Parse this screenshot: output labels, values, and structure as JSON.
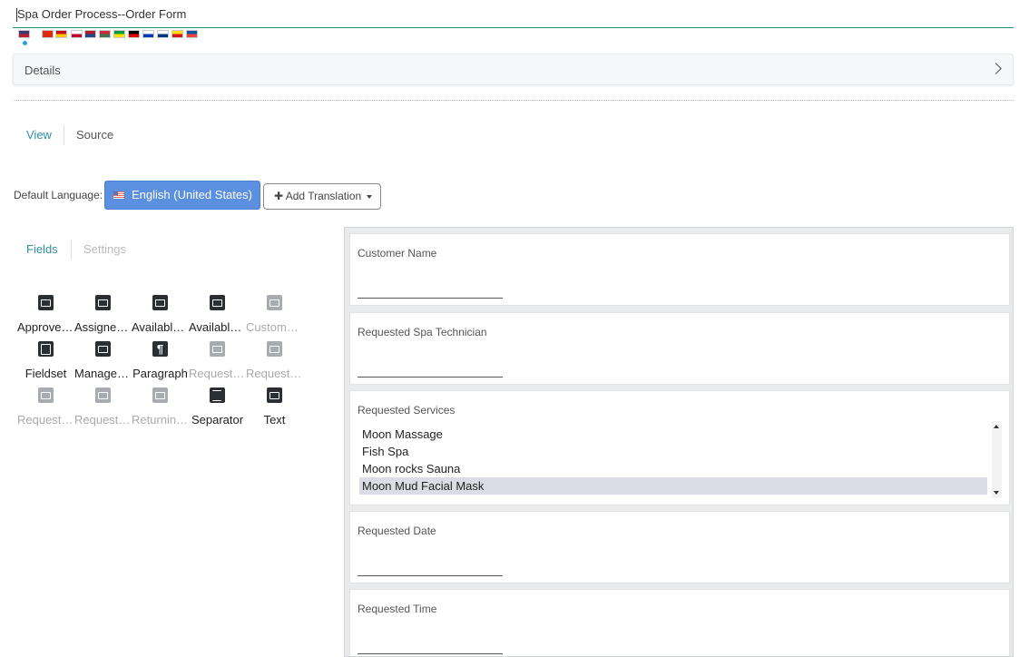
{
  "header": {
    "title": "Spa Order Process--Order Form"
  },
  "flags": [
    {
      "name": "us-flag-icon",
      "c1": "#3c3b6e",
      "c2": "#b22234"
    },
    {
      "name": "cn-flag-icon",
      "c1": "#de2910",
      "c2": "#de2910"
    },
    {
      "name": "es-flag-icon",
      "c1": "#c60b1e",
      "c2": "#ffc400"
    },
    {
      "name": "jp-flag-icon",
      "c1": "#ffffff",
      "c2": "#bc002d"
    },
    {
      "name": "nl-flag-icon",
      "c1": "#ae1c28",
      "c2": "#21468b"
    },
    {
      "name": "hu-flag-icon",
      "c1": "#ce2939",
      "c2": "#477050"
    },
    {
      "name": "br-flag-icon",
      "c1": "#009c3b",
      "c2": "#ffdf00"
    },
    {
      "name": "de-flag-icon",
      "c1": "#000000",
      "c2": "#dd0000"
    },
    {
      "name": "il-flag-icon",
      "c1": "#ffffff",
      "c2": "#0038b8"
    },
    {
      "name": "fi-flag-icon",
      "c1": "#ffffff",
      "c2": "#003580"
    },
    {
      "name": "ca-flag-icon",
      "c1": "#fcdd09",
      "c2": "#da121a"
    },
    {
      "name": "fr-flag-icon",
      "c1": "#0055a4",
      "c2": "#ef4135"
    }
  ],
  "details": {
    "label": "Details"
  },
  "view_tabs": {
    "view": "View",
    "source": "Source"
  },
  "language": {
    "label": "Default Language:",
    "selected": "English (United States)",
    "add_translation": "Add Translation"
  },
  "palette_tabs": {
    "fields": "Fields",
    "settings": "Settings"
  },
  "palette": [
    {
      "label": "Approved Assignee",
      "dim": false,
      "icon": "dark"
    },
    {
      "label": "Assigned To",
      "dim": false,
      "icon": "dark"
    },
    {
      "label": "Available Technicians",
      "dim": false,
      "icon": "dark"
    },
    {
      "label": "Available Times",
      "dim": false,
      "icon": "dark"
    },
    {
      "label": "Customer Name",
      "dim": true,
      "icon": "light"
    },
    {
      "label": "Fieldset",
      "dim": false,
      "icon": "fs"
    },
    {
      "label": "Manager Approval",
      "dim": false,
      "icon": "dark"
    },
    {
      "label": "Paragraph",
      "dim": false,
      "icon": "para"
    },
    {
      "label": "Requested Date",
      "dim": true,
      "icon": "light"
    },
    {
      "label": "Requested Services",
      "dim": true,
      "icon": "light"
    },
    {
      "label": "Requested Spa Technician",
      "dim": true,
      "icon": "light"
    },
    {
      "label": "Requested Time",
      "dim": true,
      "icon": "light"
    },
    {
      "label": "Returning Customer",
      "dim": true,
      "icon": "light"
    },
    {
      "label": "Separator",
      "dim": false,
      "icon": "sep"
    },
    {
      "label": "Text",
      "dim": false,
      "icon": "dark"
    }
  ],
  "form": {
    "customer_name": "Customer Name",
    "technician": "Requested Spa Technician",
    "services": "Requested Services",
    "service_options": [
      "Moon Massage",
      "Fish Spa",
      "Moon rocks Sauna",
      "Moon Mud Facial Mask"
    ],
    "selected_service_index": 3,
    "date": "Requested Date",
    "time": "Requested Time"
  }
}
